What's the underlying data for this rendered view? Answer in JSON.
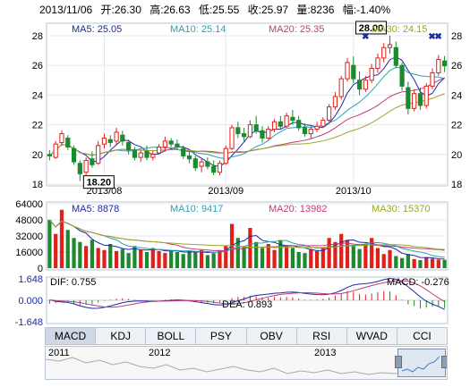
{
  "header": {
    "date": "2013/11/06",
    "open": "开:26.30",
    "high": "高:26.63",
    "low": "低:25.55",
    "close": "收:25.97",
    "volume": "量:8236",
    "change": "幅:-1.40%"
  },
  "price_panel": {
    "ma_labels": [
      {
        "text": "MA5: 25.05",
        "color": "#1a2aa6"
      },
      {
        "text": "MA10: 25.14",
        "color": "#2aa3b3"
      },
      {
        "text": "MA20: 25.35",
        "color": "#c23a7a"
      },
      {
        "text": "MA30: 24.15",
        "color": "#9aa52a"
      }
    ],
    "max_marker": "28.00",
    "min_marker": "18.20"
  },
  "volume_panel": {
    "ma_labels": [
      {
        "text": "MA5: 8878",
        "color": "#1a2aa6"
      },
      {
        "text": "MA10: 9417",
        "color": "#2aa3b3"
      },
      {
        "text": "MA20: 13982",
        "color": "#c23a7a"
      },
      {
        "text": "MA30: 15370",
        "color": "#9aa52a"
      }
    ]
  },
  "macd_panel": {
    "dif": "DIF: 0.755",
    "dea": "DEA: 0.893",
    "macd": "MACD: -0.276"
  },
  "tabs": [
    "MACD",
    "KDJ",
    "BOLL",
    "PSY",
    "OBV",
    "RSI",
    "WVAD",
    "CCI"
  ],
  "active_tab": "MACD",
  "navigator": {
    "years": [
      "2011",
      "2012",
      "2013"
    ]
  },
  "chart_data": [
    {
      "type": "candlestick",
      "ylim": [
        18,
        28.6
      ],
      "yticks": [
        18,
        20,
        22,
        24,
        26,
        28
      ],
      "x_month_labels": [
        "2013/08",
        "2013/09",
        "2013/10"
      ],
      "candles": [
        [
          20.0,
          20.3,
          19.6,
          19.9
        ],
        [
          19.8,
          20.9,
          19.7,
          20.7
        ],
        [
          20.8,
          21.6,
          20.6,
          21.4
        ],
        [
          21.1,
          21.3,
          20.3,
          20.5
        ],
        [
          20.4,
          20.6,
          19.3,
          19.5
        ],
        [
          19.4,
          19.6,
          18.2,
          18.7
        ],
        [
          18.8,
          19.8,
          18.6,
          19.6
        ],
        [
          19.7,
          20.2,
          19.1,
          19.3
        ],
        [
          19.4,
          20.9,
          19.3,
          20.6
        ],
        [
          20.7,
          21.4,
          20.4,
          21.1
        ],
        [
          21.0,
          21.3,
          20.5,
          20.8
        ],
        [
          20.9,
          21.8,
          20.7,
          21.5
        ],
        [
          21.3,
          21.6,
          20.6,
          20.9
        ],
        [
          20.8,
          21.0,
          20.0,
          20.3
        ],
        [
          20.3,
          20.5,
          19.6,
          19.8
        ],
        [
          19.8,
          20.3,
          19.5,
          20.1
        ],
        [
          20.2,
          20.6,
          19.6,
          19.8
        ],
        [
          19.8,
          20.2,
          19.6,
          20.0
        ],
        [
          20.1,
          20.7,
          20.0,
          20.5
        ],
        [
          20.5,
          21.2,
          20.2,
          20.9
        ],
        [
          20.9,
          21.1,
          20.5,
          20.7
        ],
        [
          20.7,
          21.0,
          20.3,
          20.5
        ],
        [
          20.4,
          20.6,
          19.7,
          19.9
        ],
        [
          19.9,
          20.2,
          19.4,
          19.7
        ],
        [
          19.7,
          19.9,
          18.9,
          19.1
        ],
        [
          19.2,
          19.7,
          18.8,
          19.5
        ],
        [
          19.5,
          19.8,
          19.0,
          19.2
        ],
        [
          19.2,
          19.6,
          18.6,
          18.8
        ],
        [
          18.8,
          19.6,
          18.6,
          19.4
        ],
        [
          19.4,
          20.6,
          19.3,
          20.4
        ],
        [
          20.4,
          22.0,
          20.3,
          21.8
        ],
        [
          21.8,
          22.2,
          21.1,
          21.4
        ],
        [
          21.4,
          21.8,
          20.9,
          21.2
        ],
        [
          21.2,
          22.3,
          21.1,
          22.0
        ],
        [
          22.0,
          22.6,
          21.4,
          21.6
        ],
        [
          21.6,
          21.9,
          20.8,
          21.1
        ],
        [
          21.1,
          21.9,
          21.0,
          21.7
        ],
        [
          21.7,
          22.4,
          21.5,
          22.2
        ],
        [
          22.2,
          22.6,
          21.7,
          21.9
        ],
        [
          21.9,
          22.8,
          21.8,
          22.6
        ],
        [
          22.5,
          23.0,
          22.0,
          22.3
        ],
        [
          22.3,
          22.6,
          21.6,
          21.8
        ],
        [
          21.8,
          22.1,
          21.2,
          21.4
        ],
        [
          21.4,
          21.9,
          21.1,
          21.7
        ],
        [
          21.7,
          22.2,
          21.5,
          21.9
        ],
        [
          21.9,
          22.5,
          21.8,
          22.3
        ],
        [
          22.3,
          23.4,
          22.1,
          23.2
        ],
        [
          23.2,
          24.2,
          23.0,
          23.9
        ],
        [
          23.9,
          25.3,
          23.7,
          25.1
        ],
        [
          25.1,
          26.5,
          24.9,
          26.2
        ],
        [
          26.0,
          26.6,
          24.8,
          25.1
        ],
        [
          25.0,
          25.6,
          24.0,
          24.4
        ],
        [
          24.4,
          25.3,
          24.2,
          25.0
        ],
        [
          25.0,
          26.1,
          24.8,
          25.8
        ],
        [
          25.8,
          26.8,
          25.5,
          26.5
        ],
        [
          26.5,
          27.5,
          26.2,
          27.2
        ],
        [
          27.2,
          28.0,
          26.8,
          27.4
        ],
        [
          27.2,
          27.6,
          25.8,
          26.0
        ],
        [
          26.0,
          26.2,
          24.3,
          24.6
        ],
        [
          24.5,
          24.9,
          22.7,
          23.1
        ],
        [
          23.1,
          24.4,
          22.9,
          24.1
        ],
        [
          24.1,
          24.5,
          23.0,
          23.3
        ],
        [
          23.3,
          24.8,
          23.1,
          24.6
        ],
        [
          24.6,
          25.8,
          24.4,
          25.5
        ],
        [
          25.5,
          26.7,
          25.3,
          26.4
        ],
        [
          26.3,
          26.63,
          25.55,
          25.97
        ]
      ]
    },
    {
      "type": "bar",
      "name": "volume",
      "ylim": [
        0,
        64000
      ],
      "yticks": [
        0,
        16000,
        32000,
        48000,
        64000
      ],
      "values": [
        48000,
        34000,
        58000,
        38000,
        30000,
        26000,
        22000,
        28000,
        20000,
        18000,
        24000,
        17000,
        19000,
        15000,
        22000,
        18000,
        16000,
        20000,
        17000,
        15000,
        18000,
        16000,
        14000,
        17000,
        16000,
        18000,
        13000,
        15000,
        18000,
        22000,
        44000,
        30000,
        22000,
        40000,
        26000,
        20000,
        24000,
        18000,
        28000,
        22000,
        20000,
        16000,
        15000,
        19000,
        17000,
        21000,
        30000,
        26000,
        34000,
        28000,
        22000,
        19000,
        24000,
        30000,
        20000,
        14000,
        18000,
        12000,
        10000,
        14000,
        9000,
        8000,
        11000,
        9500,
        8500,
        8236
      ]
    },
    {
      "type": "bar",
      "name": "macd",
      "ylim": [
        -1.648,
        1.648
      ],
      "yticks": [
        -1.648,
        0.0,
        1.648
      ],
      "macd_hist": [
        -0.12,
        -0.1,
        -0.06,
        -0.05,
        -0.12,
        -0.18,
        -0.16,
        -0.14,
        -0.08,
        -0.02,
        0.02,
        0.06,
        0.07,
        0.05,
        0.02,
        0.0,
        -0.02,
        -0.02,
        0.0,
        0.02,
        0.03,
        0.02,
        -0.01,
        -0.04,
        -0.07,
        -0.08,
        -0.09,
        -0.1,
        -0.08,
        -0.02,
        0.08,
        0.12,
        0.12,
        0.16,
        0.14,
        0.1,
        0.1,
        0.12,
        0.1,
        0.12,
        0.1,
        0.06,
        0.02,
        0.02,
        0.03,
        0.05,
        0.1,
        0.16,
        0.24,
        0.32,
        0.3,
        0.22,
        0.2,
        0.24,
        0.28,
        0.32,
        0.3,
        0.18,
        0.02,
        -0.14,
        -0.2,
        -0.28,
        -0.26,
        -0.22,
        -0.2,
        -0.276
      ]
    }
  ]
}
